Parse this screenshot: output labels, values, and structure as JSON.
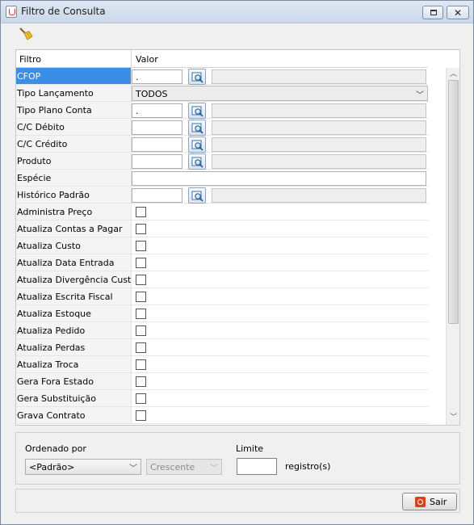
{
  "window": {
    "title": "Filtro de Consulta",
    "icon": "java-cup-icon"
  },
  "toolbar": {
    "clear_icon": "broom-icon"
  },
  "table": {
    "headers": [
      "Filtro",
      "Valor"
    ],
    "rows": [
      {
        "label": "CFOP",
        "type": "lookup",
        "value": ".",
        "selected": true
      },
      {
        "label": "Tipo Lançamento",
        "type": "combo",
        "value": "TODOS"
      },
      {
        "label": "Tipo Plano Conta",
        "type": "lookup",
        "value": "   ."
      },
      {
        "label": "C/C Débito",
        "type": "lookup",
        "value": ""
      },
      {
        "label": "C/C Crédito",
        "type": "lookup",
        "value": ""
      },
      {
        "label": "Produto",
        "type": "lookup",
        "value": ""
      },
      {
        "label": "Espécie",
        "type": "text",
        "value": ""
      },
      {
        "label": "Histórico Padrão",
        "type": "lookup",
        "value": ""
      },
      {
        "label": "Administra Preço",
        "type": "check",
        "checked": false
      },
      {
        "label": "Atualiza Contas a Pagar",
        "type": "check",
        "checked": false
      },
      {
        "label": "Atualiza Custo",
        "type": "check",
        "checked": false
      },
      {
        "label": "Atualiza Data Entrada",
        "type": "check",
        "checked": false
      },
      {
        "label": "Atualiza Divergência Custo",
        "type": "check",
        "checked": false
      },
      {
        "label": "Atualiza Escrita Fiscal",
        "type": "check",
        "checked": false
      },
      {
        "label": "Atualiza Estoque",
        "type": "check",
        "checked": false
      },
      {
        "label": "Atualiza Pedido",
        "type": "check",
        "checked": false
      },
      {
        "label": "Atualiza Perdas",
        "type": "check",
        "checked": false
      },
      {
        "label": "Atualiza Troca",
        "type": "check",
        "checked": false
      },
      {
        "label": "Gera Fora Estado",
        "type": "check",
        "checked": false
      },
      {
        "label": "Gera Substituição",
        "type": "check",
        "checked": false
      },
      {
        "label": "Grava Contrato",
        "type": "check",
        "checked": false
      }
    ]
  },
  "order": {
    "label": "Ordenado por",
    "order_value": "<Padrão>",
    "direction_value": "Crescente",
    "limit_label": "Limite",
    "limit_value": "",
    "registros_label": "registro(s)"
  },
  "footer": {
    "exit_label": "Sair",
    "exit_icon": "exit-icon"
  },
  "colors": {
    "selection": "#3a8ee6",
    "exit": "#d9401f"
  }
}
